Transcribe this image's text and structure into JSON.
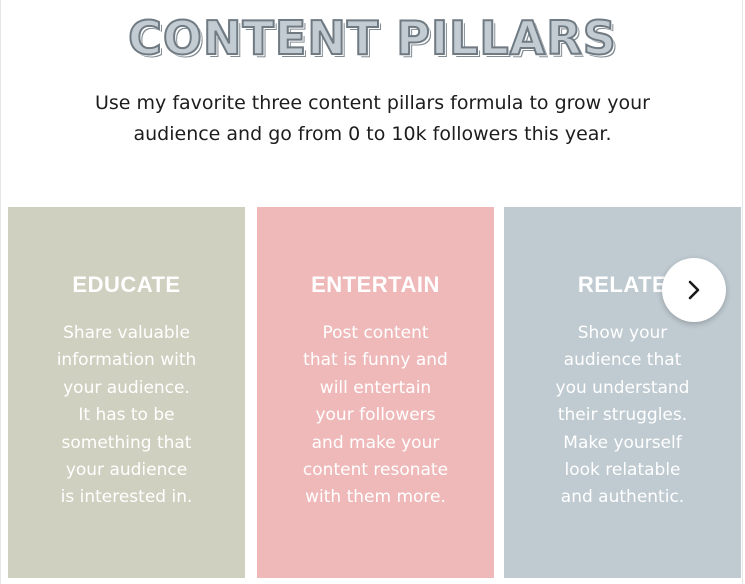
{
  "header": {
    "title": "CONTENT PILLARS",
    "subtitle_lines": [
      "Use my favorite three content pillars formula to grow your",
      "audience and go from 0 to 10k followers this year."
    ]
  },
  "cards": [
    {
      "title": "EDUCATE",
      "color": "#cfd0bf",
      "lines": [
        "Share valuable",
        "information with",
        "your audience.",
        "It has to be",
        "something that",
        "your audience",
        "is interested in."
      ]
    },
    {
      "title": "ENTERTAIN",
      "color": "#efb9ba",
      "lines": [
        "Post content",
        "that is funny and",
        "will entertain",
        "your followers",
        "and make your",
        "content resonate",
        "with them more."
      ]
    },
    {
      "title": "RELATE",
      "color": "#bfcad1",
      "lines": [
        "Show your",
        "audience that",
        "you understand",
        "their struggles.",
        "Make yourself",
        "look relatable",
        "and authentic."
      ]
    }
  ],
  "carousel": {
    "next_icon": "chevron-right-icon"
  }
}
